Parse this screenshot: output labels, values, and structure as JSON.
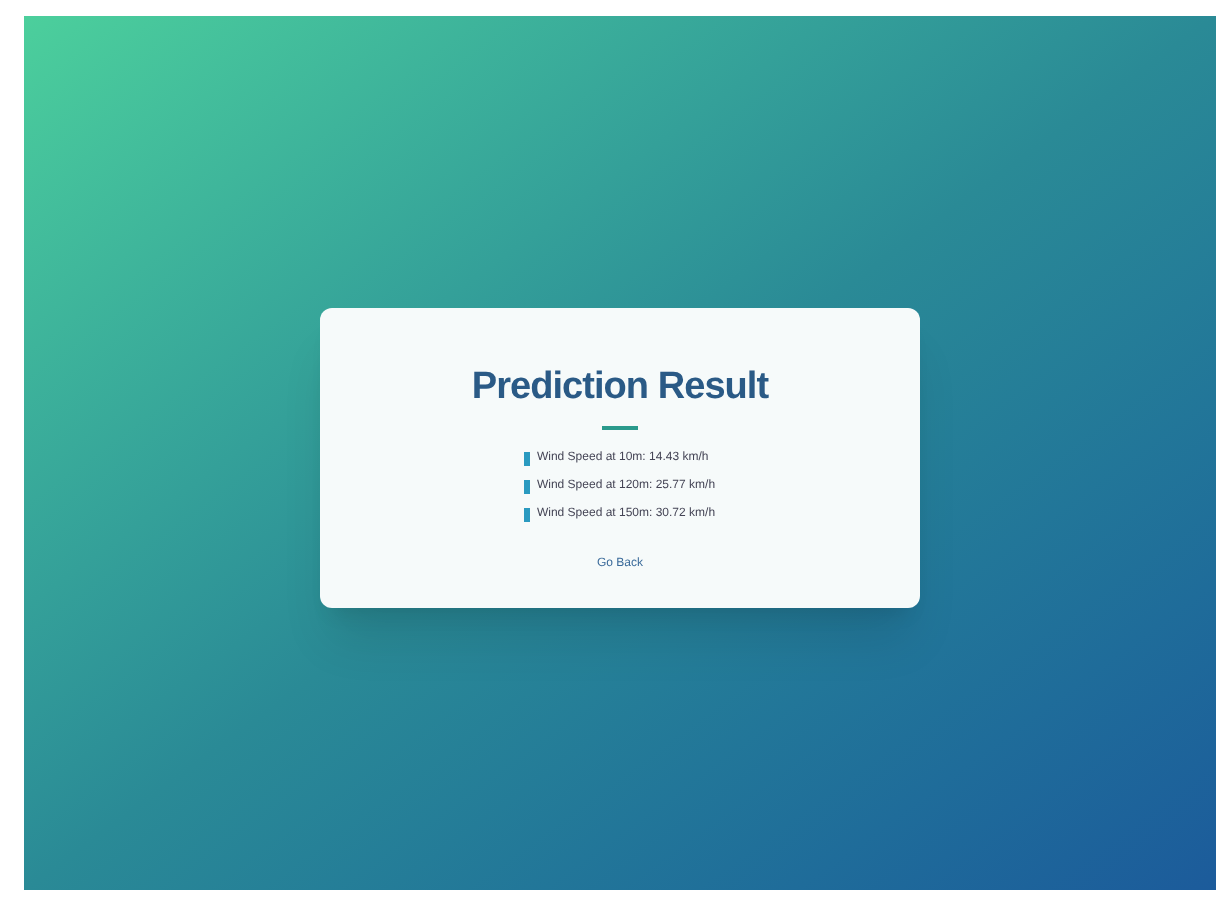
{
  "title": "Prediction Result",
  "results": [
    {
      "label": "Wind Speed at 10m:",
      "value": "14.43 km/h"
    },
    {
      "label": "Wind Speed at 120m:",
      "value": "25.77 km/h"
    },
    {
      "label": "Wind Speed at 150m:",
      "value": "30.72 km/h"
    }
  ],
  "link": "Go Back"
}
